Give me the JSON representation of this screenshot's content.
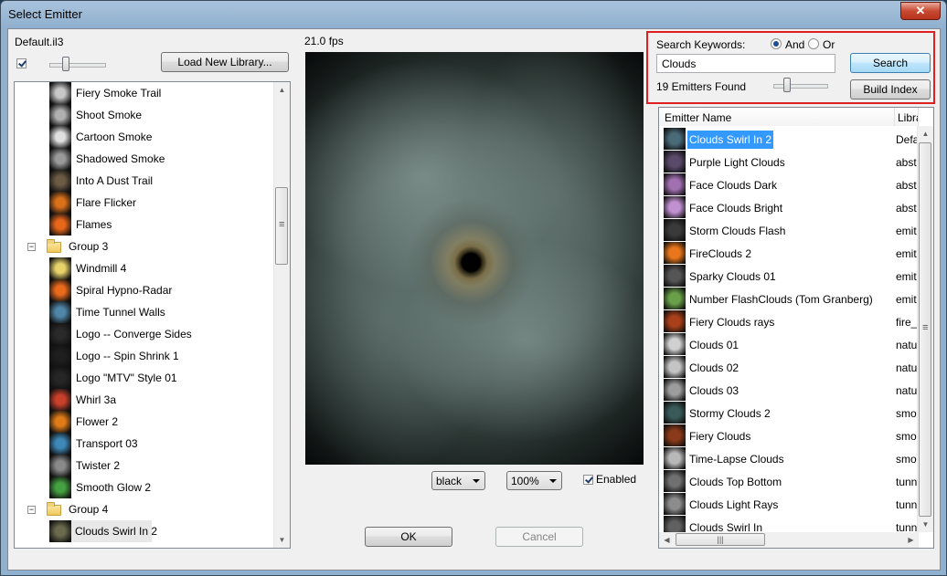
{
  "window": {
    "title": "Select Emitter",
    "close_glyph": "✕"
  },
  "library": {
    "name": "Default.il3",
    "load_button": "Load New Library..."
  },
  "fps": "21.0 fps",
  "tree": {
    "items": [
      {
        "type": "emitter",
        "label": "Fiery Smoke Trail",
        "color": "#c8c8c8"
      },
      {
        "type": "emitter",
        "label": "Shoot Smoke",
        "color": "#b0b0b0"
      },
      {
        "type": "emitter",
        "label": "Cartoon Smoke",
        "color": "#e0e0e0"
      },
      {
        "type": "emitter",
        "label": "Shadowed Smoke",
        "color": "#9a9a9a"
      },
      {
        "type": "emitter",
        "label": "Into A Dust Trail",
        "color": "#6b5a44"
      },
      {
        "type": "emitter",
        "label": "Flare Flicker",
        "color": "#d9701a"
      },
      {
        "type": "emitter",
        "label": "Flames",
        "color": "#e8661a"
      },
      {
        "type": "group",
        "label": "Group 3"
      },
      {
        "type": "emitter",
        "label": "Windmill 4",
        "color": "#e8d36a"
      },
      {
        "type": "emitter",
        "label": "Spiral Hypno-Radar",
        "color": "#ea6a1c"
      },
      {
        "type": "emitter",
        "label": "Time Tunnel Walls",
        "color": "#4f86a8"
      },
      {
        "type": "emitter",
        "label": "Logo -- Converge Sides",
        "color": "#2a2a2a"
      },
      {
        "type": "emitter",
        "label": "Logo -- Spin Shrink 1",
        "color": "#1e1e1e"
      },
      {
        "type": "emitter",
        "label": "Logo \"MTV\" Style 01",
        "color": "#262626"
      },
      {
        "type": "emitter",
        "label": "Whirl 3a",
        "color": "#c8402a"
      },
      {
        "type": "emitter",
        "label": "Flower 2",
        "color": "#e07b18"
      },
      {
        "type": "emitter",
        "label": "Transport 03",
        "color": "#3e88b8"
      },
      {
        "type": "emitter",
        "label": "Twister 2",
        "color": "#8a8a8a"
      },
      {
        "type": "emitter",
        "label": "Smooth Glow 2",
        "color": "#44a040"
      },
      {
        "type": "group",
        "label": "Group 4"
      },
      {
        "type": "emitter",
        "label": "Clouds Swirl In 2",
        "color": "#6b6a4e",
        "highlight": true
      }
    ]
  },
  "preview_controls": {
    "background_value": "black",
    "zoom_value": "100%",
    "enabled_label": "Enabled"
  },
  "dialog_buttons": {
    "ok": "OK",
    "cancel": "Cancel"
  },
  "search": {
    "keywords_label": "Search Keywords:",
    "and_label": "And",
    "or_label": "Or",
    "query": "Clouds",
    "search_button": "Search",
    "found_text": "19 Emitters Found",
    "build_index_button": "Build Index"
  },
  "results": {
    "columns": [
      "Emitter Name",
      "Libra"
    ],
    "rows": [
      {
        "name": "Clouds Swirl In 2",
        "lib": "Defa",
        "color": "#4a6a78",
        "selected": true
      },
      {
        "name": "Purple Light Clouds",
        "lib": "abst",
        "color": "#5a4a6a"
      },
      {
        "name": "Face Clouds Dark",
        "lib": "abst",
        "color": "#a070b0"
      },
      {
        "name": "Face Clouds Bright",
        "lib": "abst",
        "color": "#c090d0"
      },
      {
        "name": "Storm Clouds Flash",
        "lib": "emit",
        "color": "#3a3a3a"
      },
      {
        "name": "FireClouds 2",
        "lib": "emit",
        "color": "#e8761c"
      },
      {
        "name": "Sparky Clouds 01",
        "lib": "emit",
        "color": "#555555"
      },
      {
        "name": "Number FlashClouds (Tom Granberg)",
        "lib": "emit",
        "color": "#6aa04a"
      },
      {
        "name": "Fiery Clouds rays",
        "lib": "fire_",
        "color": "#a8401a"
      },
      {
        "name": "Clouds 01",
        "lib": "natu",
        "color": "#d0d0d0"
      },
      {
        "name": "Clouds 02",
        "lib": "natu",
        "color": "#c4c4c4"
      },
      {
        "name": "Clouds 03",
        "lib": "natu",
        "color": "#9c9c9c"
      },
      {
        "name": "Stormy Clouds 2",
        "lib": "smo",
        "color": "#3a5a5a"
      },
      {
        "name": "Fiery Clouds",
        "lib": "smo",
        "color": "#8a3a1a"
      },
      {
        "name": "Time-Lapse Clouds",
        "lib": "smo",
        "color": "#b8b8b8"
      },
      {
        "name": "Clouds Top Bottom",
        "lib": "tunn",
        "color": "#707070"
      },
      {
        "name": "Clouds Light Rays",
        "lib": "tunn",
        "color": "#8c8c8c"
      },
      {
        "name": "Clouds Swirl In",
        "lib": "tunn",
        "color": "#606060"
      }
    ]
  },
  "scroll_glyphs": {
    "up": "▲",
    "down": "▼",
    "left": "◀",
    "right": "▶",
    "grip": "|||"
  }
}
